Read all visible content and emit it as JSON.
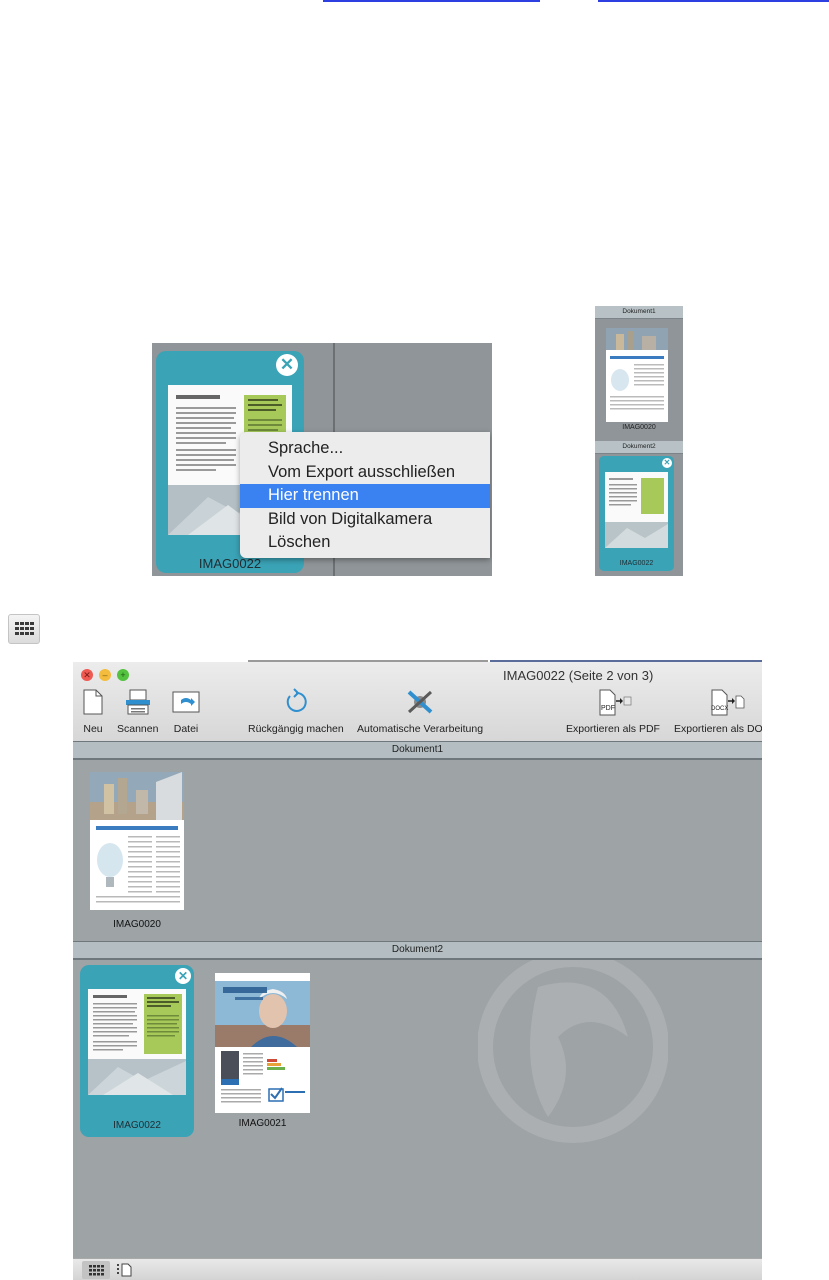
{
  "context_menu": {
    "items": [
      {
        "label": "Sprache..."
      },
      {
        "label": "Vom Export ausschließen"
      },
      {
        "label": "Hier trennen"
      },
      {
        "label": "Bild von Digitalkamera"
      },
      {
        "label": "Löschen"
      }
    ],
    "selected_item": "Hier trennen",
    "page_caption": "IMAG0022"
  },
  "side_panel": {
    "doc1_label": "Dokument1",
    "doc1_page": "IMAG0020",
    "doc2_label": "Dokument2",
    "doc2_page": "IMAG0022"
  },
  "window": {
    "title": "IMAG0022 (Seite 2 von 3)",
    "toolbar": {
      "new": "Neu",
      "scan": "Scannen",
      "file": "Datei",
      "undo": "Rückgängig machen",
      "auto": "Automatische Verarbeitung",
      "export_pdf": "Exportieren als PDF",
      "export_docx": "Exportieren als DOCX",
      "pdf_badge": "PDF",
      "docx_badge": "DOCX"
    },
    "documents": [
      {
        "label": "Dokument1",
        "pages": [
          "IMAG0020"
        ]
      },
      {
        "label": "Dokument2",
        "pages": [
          "IMAG0022",
          "IMAG0021"
        ]
      }
    ]
  },
  "colors": {
    "selection": "#3aa3b6",
    "menu_highlight": "#3a82f1",
    "canvas": "#9ea3a6"
  },
  "icons": [
    "close-icon",
    "new-document-icon",
    "scanner-icon",
    "folder-import-icon",
    "undo-icon",
    "magic-wand-icon",
    "export-pdf-icon",
    "export-docx-icon",
    "grid-view-icon",
    "page-view-icon"
  ]
}
